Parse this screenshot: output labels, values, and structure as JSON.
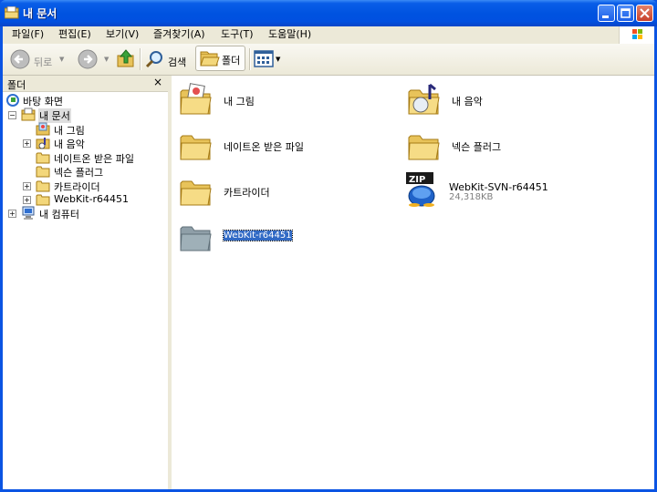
{
  "window": {
    "title": "내 문서"
  },
  "menu": [
    "파일(F)",
    "편집(E)",
    "보기(V)",
    "즐겨찾기(A)",
    "도구(T)",
    "도움말(H)"
  ],
  "toolbar": {
    "back_label": "뒤로",
    "search_label": "검색",
    "folders_label": "폴더"
  },
  "folders_pane": {
    "title": "폴더",
    "close": "×",
    "tree": [
      {
        "label": "바탕 화면",
        "icon": "desktop-icon"
      },
      {
        "label": "내 문서",
        "icon": "my-documents-icon",
        "expanded": true,
        "selected": true
      },
      {
        "label": "내 그림",
        "icon": "my-pictures-icon"
      },
      {
        "label": "내 음악",
        "icon": "my-music-icon"
      },
      {
        "label": "네이트온 받은 파일",
        "icon": "folder-icon"
      },
      {
        "label": "넥슨 플러그",
        "icon": "folder-icon"
      },
      {
        "label": "카트라이더",
        "icon": "folder-icon"
      },
      {
        "label": "WebKit-r64451",
        "icon": "folder-icon"
      },
      {
        "label": "내 컴퓨터",
        "icon": "my-computer-icon"
      }
    ]
  },
  "files": [
    {
      "name": "내 그림",
      "icon": "my-pictures-folder-icon"
    },
    {
      "name": "내 음악",
      "icon": "my-music-folder-icon"
    },
    {
      "name": "네이트온 받은 파일",
      "icon": "folder-icon"
    },
    {
      "name": "넥슨 플러그",
      "icon": "folder-icon"
    },
    {
      "name": "카트라이더",
      "icon": "folder-icon"
    },
    {
      "name": "WebKit-SVN-r64451",
      "sub": "24,318KB",
      "icon": "zip-file-icon"
    },
    {
      "name": "WebKit-r64451",
      "icon": "folder-icon",
      "selected": true
    }
  ],
  "colors": {
    "titlebar": "#0053e0",
    "selection": "#316ac5",
    "chrome": "#ece9d8"
  }
}
